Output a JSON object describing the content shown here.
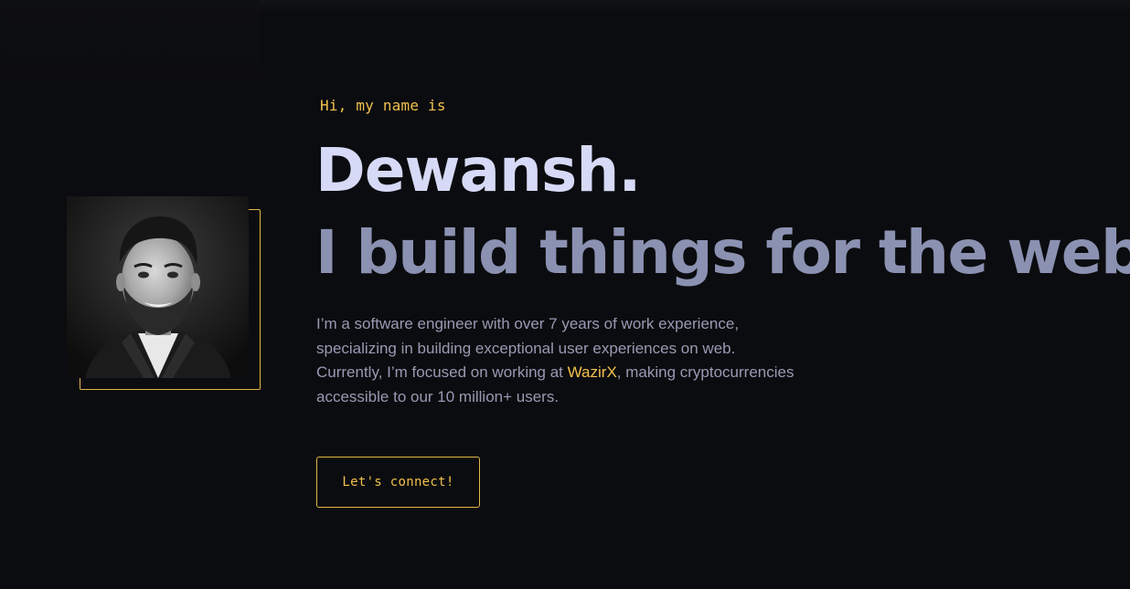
{
  "hero": {
    "greeting": "Hi, my name is",
    "name": "Dewansh.",
    "tagline": "I build things for the web.",
    "bio": {
      "line1": "I’m a software engineer with over 7 years of work experience,",
      "line2": "specializing in building exceptional user experiences on web.",
      "line3_before": "Currently, I’m focused on working at ",
      "line3_link": "WazirX",
      "line3_after": ", making cryptocurrencies",
      "line4": "accessible to our 10 million+ users."
    },
    "cta_label": "Let's connect!"
  },
  "colors": {
    "background": "#0b0c0f",
    "accent": "#f2c14e",
    "name": "#d6daf6",
    "tagline": "#8b91b1",
    "body_text": "#979bb3"
  }
}
